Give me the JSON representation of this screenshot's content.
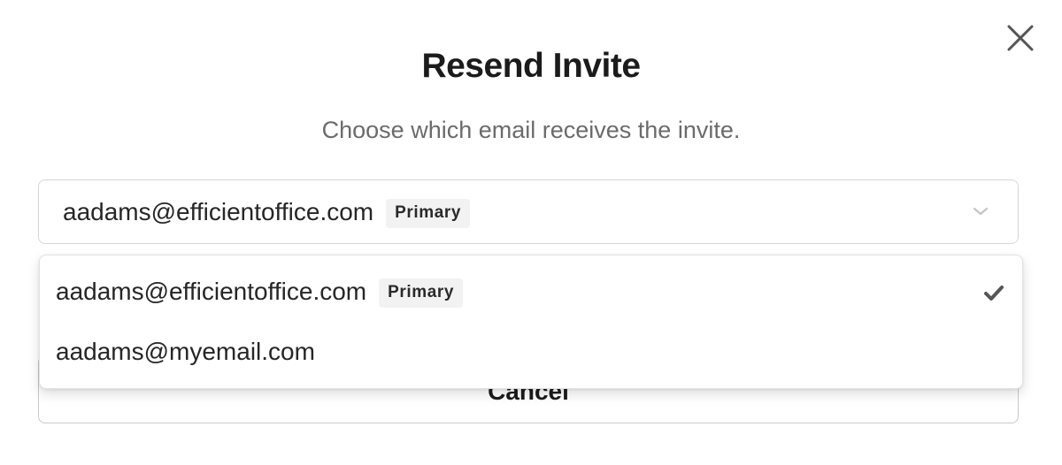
{
  "dialog": {
    "title": "Resend Invite",
    "subtitle": "Choose which email receives the invite.",
    "close_icon": "close-icon"
  },
  "select": {
    "value": "aadams@efficientoffice.com",
    "badge": "Primary",
    "chevron_icon": "chevron-down-icon"
  },
  "dropdown": {
    "options": [
      {
        "label": "aadams@efficientoffice.com",
        "badge": "Primary",
        "selected": true,
        "icon": "checkmark-icon"
      },
      {
        "label": "aadams@myemail.com",
        "badge": "",
        "selected": false
      }
    ]
  },
  "actions": {
    "cancel_label": "Cancel"
  },
  "colors": {
    "title": "#1b1b1b",
    "subtitle": "#6b6b6b",
    "badge_bg": "#f2f2f2",
    "border": "#d7d7d7",
    "icon": "#555555"
  }
}
